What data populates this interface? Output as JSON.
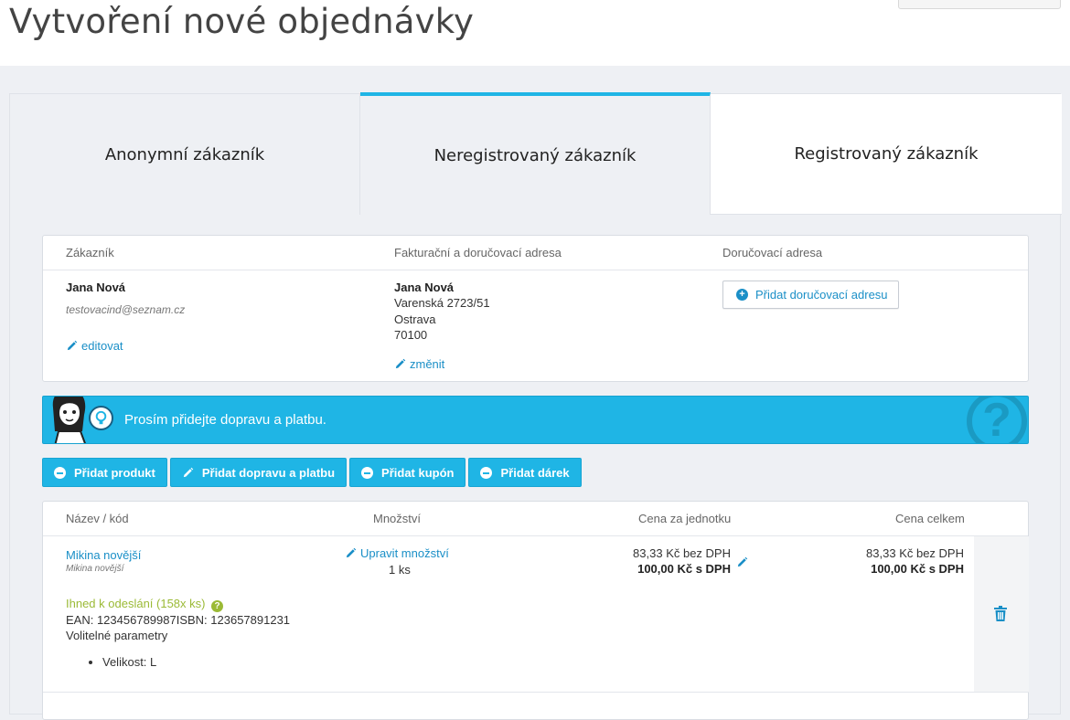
{
  "page": {
    "title": "Vytvoření nové objednávky"
  },
  "tabs": [
    {
      "label": "Anonymní zákazník"
    },
    {
      "label": "Neregistrovaný zákazník"
    },
    {
      "label": "Registrovaný zákazník"
    }
  ],
  "customer_panel": {
    "headers": {
      "customer": "Zákazník",
      "billing": "Fakturační a doručovací adresa",
      "delivery": "Doručovací adresa"
    },
    "customer": {
      "name": "Jana Nová",
      "email": "testovacind@seznam.cz",
      "edit_label": "editovat"
    },
    "billing": {
      "name": "Jana Nová",
      "street": "Varenská 2723/51",
      "city": "Ostrava",
      "zip": "70100",
      "change_label": "změnit"
    },
    "delivery": {
      "add_label": "Přidat doručovací adresu"
    }
  },
  "alert": {
    "message": "Prosím přidejte dopravu a platbu."
  },
  "actions": {
    "add_product": "Přidat produkt",
    "add_shipping_payment": "Přidat dopravu a platbu",
    "add_coupon": "Přidat kupón",
    "add_gift": "Přidat dárek"
  },
  "products_table": {
    "headers": {
      "name": "Název / kód",
      "quantity": "Množství",
      "unit_price": "Cena za jednotku",
      "total_price": "Cena celkem"
    },
    "rows": [
      {
        "name": "Mikina novější",
        "code": "Mikina novější",
        "edit_qty_label": "Upravit množství",
        "quantity": "1 ks",
        "unit_price_excl": "83,33 Kč bez DPH",
        "unit_price_incl": "100,00 Kč s DPH",
        "total_excl": "83,33 Kč bez DPH",
        "total_incl": "100,00 Kč s DPH",
        "availability": "Ihned k odeslání (158x ks)",
        "ean": "EAN: 123456789987ISBN: 123657891231",
        "optional_params_label": "Volitelné parametry",
        "params": [
          "Velikost: L"
        ]
      }
    ]
  },
  "colors": {
    "accent": "#1fb5e5",
    "link": "#1a8fc7",
    "availability": "#9bba36"
  }
}
